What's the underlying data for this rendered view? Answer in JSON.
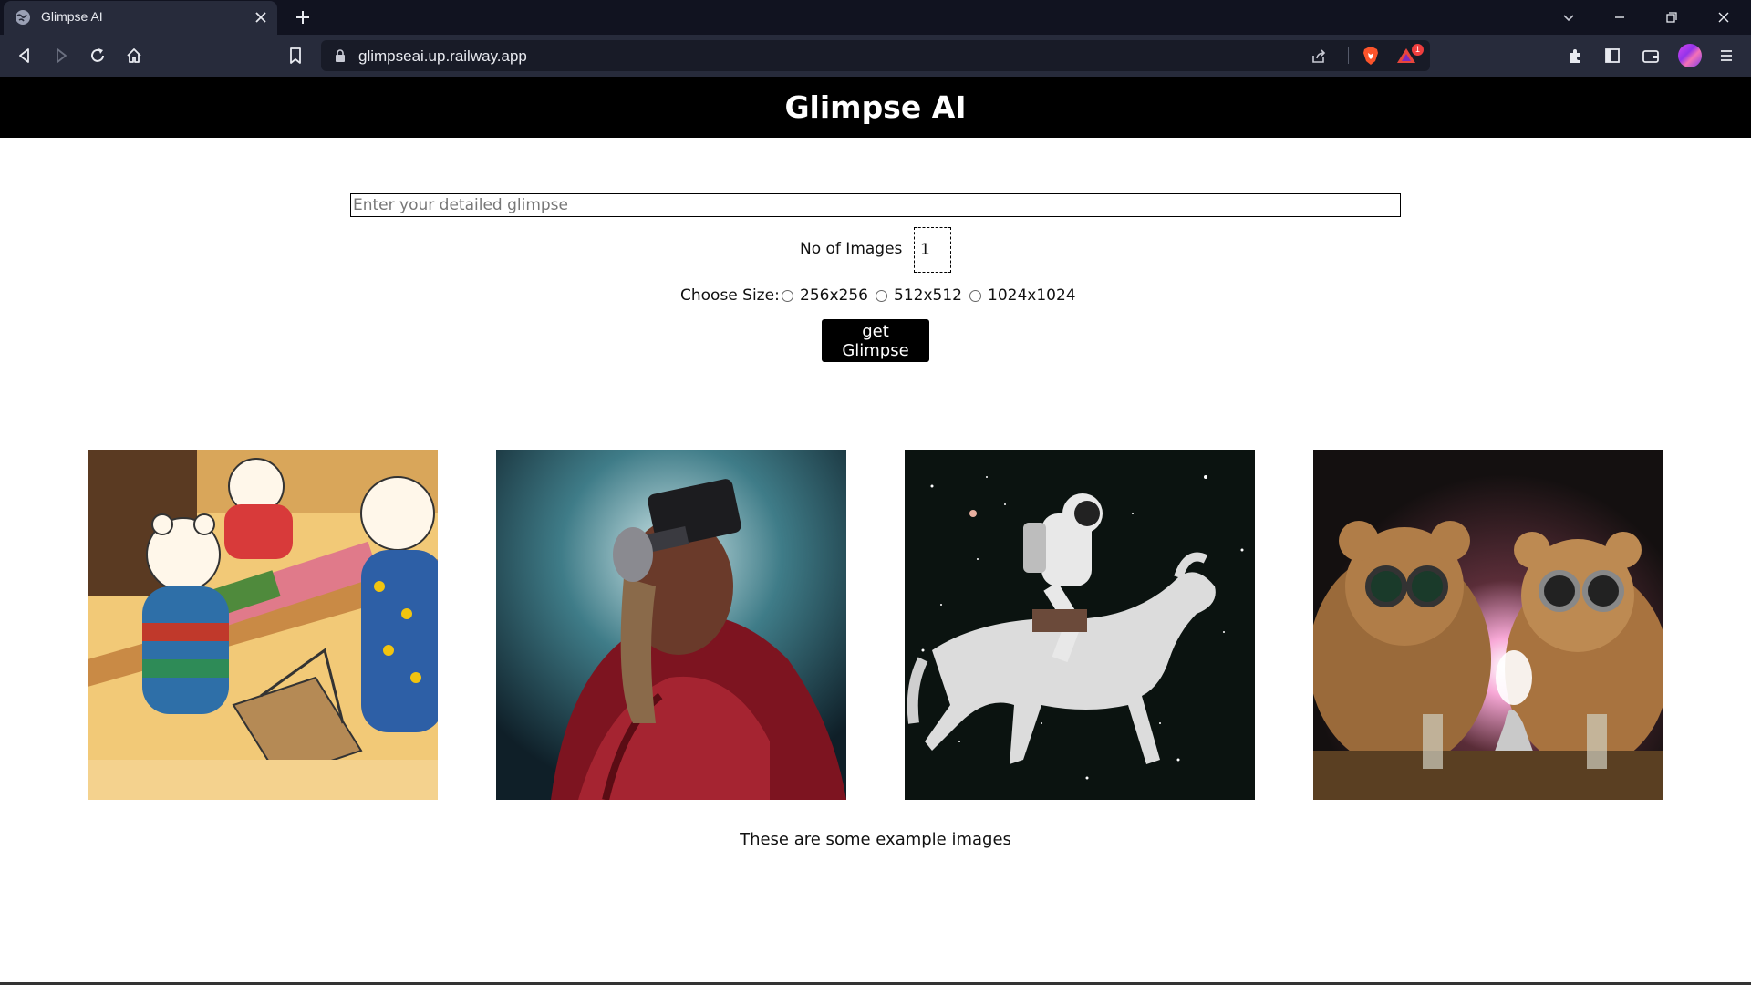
{
  "browser": {
    "tab_title": "Glimpse AI",
    "url": "glimpseai.up.railway.app",
    "notification_count": "1"
  },
  "page": {
    "title": "Glimpse AI",
    "prompt_placeholder": "Enter your detailed glimpse",
    "prompt_value": "",
    "count_label": "No of Images",
    "count_value": "1",
    "size_label": "Choose Size:",
    "size_options": [
      "256x256",
      "512x512",
      "1024x1024"
    ],
    "button_label": "get Glimpse",
    "caption": "These are some example images"
  }
}
